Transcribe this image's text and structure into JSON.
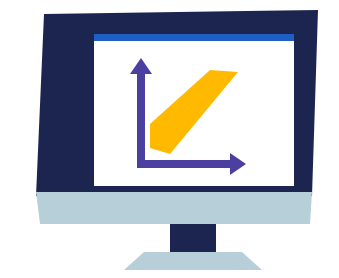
{
  "illustration": {
    "subject": "computer-monitor-chart-icon",
    "colors": {
      "frame": "#1b2550",
      "screen": "#ffffff",
      "screen_top_bar": "#1f5fc4",
      "chin": "#b6cfd9",
      "stand_neck": "#1b2550",
      "stand_base": "#b6cfd9",
      "axes": "#4b3fa0",
      "chart_band": "#ffba00"
    },
    "icons": [
      "monitor-icon",
      "chart-axes-icon"
    ]
  }
}
